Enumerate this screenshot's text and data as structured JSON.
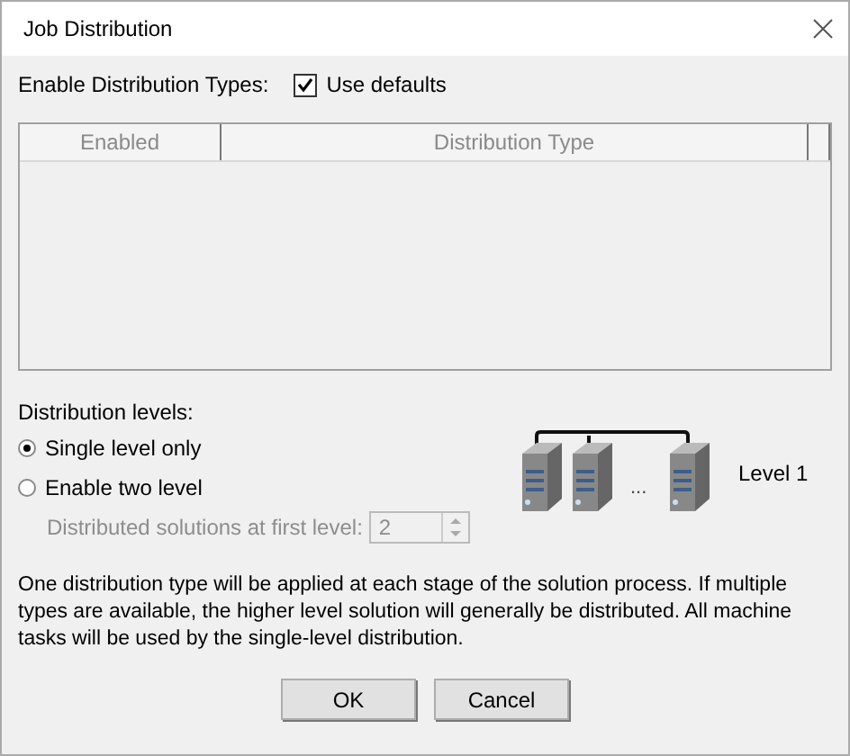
{
  "window": {
    "title": "Job Distribution"
  },
  "distribution_types": {
    "label": "Enable Distribution Types:",
    "use_defaults": {
      "label": "Use defaults",
      "checked": true
    }
  },
  "table": {
    "columns": [
      "Enabled",
      "Distribution Type"
    ]
  },
  "distribution_levels": {
    "label": "Distribution levels:",
    "options": [
      {
        "label": "Single level only",
        "selected": true
      },
      {
        "label": "Enable two level",
        "selected": false
      }
    ],
    "first_level": {
      "label": "Distributed solutions at first level:",
      "value": "2",
      "disabled": true
    }
  },
  "diagram": {
    "ellipsis": "...",
    "label": "Level 1"
  },
  "description": "One distribution type will be applied at each stage of the solution process. If multiple types are available, the higher level solution will generally be distributed. All machine tasks will be used by the single-level distribution.",
  "buttons": [
    "OK",
    "Cancel"
  ]
}
